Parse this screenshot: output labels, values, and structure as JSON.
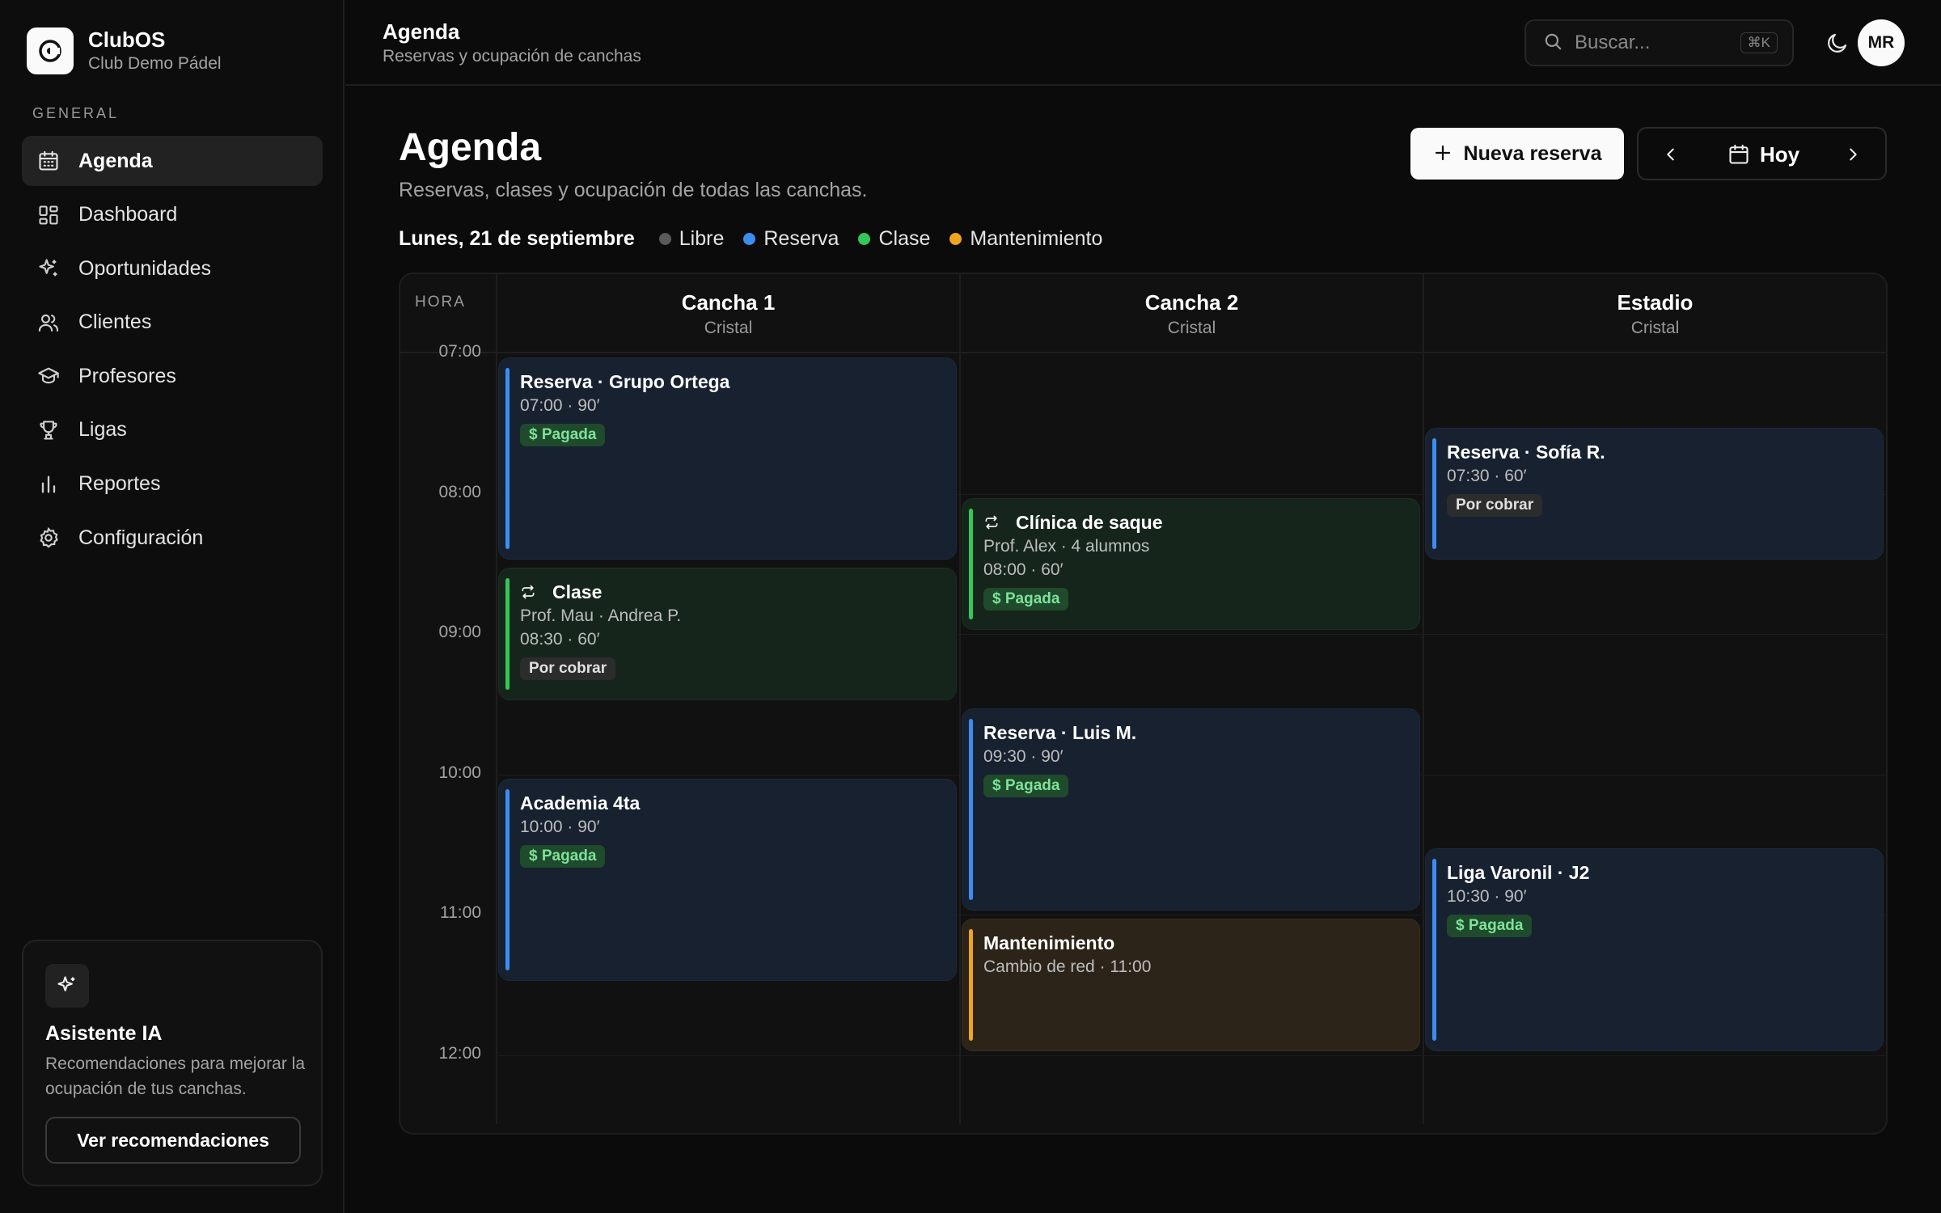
{
  "brand": {
    "name": "ClubOS",
    "club": "Club Demo Pádel"
  },
  "sidebar": {
    "section": "GENERAL",
    "items": [
      {
        "label": "Agenda",
        "icon": "calendar-icon",
        "active": true
      },
      {
        "label": "Dashboard",
        "icon": "grid-icon"
      },
      {
        "label": "Oportunidades",
        "icon": "sparkles-icon"
      },
      {
        "label": "Clientes",
        "icon": "users-icon"
      },
      {
        "label": "Profesores",
        "icon": "graduation-cap-icon"
      },
      {
        "label": "Ligas",
        "icon": "trophy-icon"
      },
      {
        "label": "Reportes",
        "icon": "bar-chart-icon"
      },
      {
        "label": "Configuración",
        "icon": "gear-icon"
      }
    ],
    "ai_card": {
      "title": "Asistente IA",
      "description": "Recomendaciones para mejorar la ocupación de tus canchas.",
      "button": "Ver recomendaciones"
    }
  },
  "topbar": {
    "title": "Agenda",
    "subtitle": "Reservas y ocupación de canchas",
    "search_placeholder": "Buscar...",
    "shortcut": "⌘K",
    "avatar_initials": "MR"
  },
  "main": {
    "title": "Agenda",
    "subtitle": "Reservas, clases y ocupación de todas las canchas.",
    "new_button": "Nueva reserva",
    "today_button": "Hoy",
    "date": "Lunes, 21 de septiembre",
    "legend": [
      {
        "label": "Libre",
        "color": "#5a5a5a"
      },
      {
        "label": "Reserva",
        "color": "#3b8ef0"
      },
      {
        "label": "Clase",
        "color": "#34c759"
      },
      {
        "label": "Mantenimiento",
        "color": "#f0a51f"
      }
    ]
  },
  "calendar": {
    "hour_header": "HORA",
    "times": [
      "07:00",
      "08:00",
      "09:00",
      "10:00",
      "11:00",
      "12:00"
    ],
    "courts": [
      {
        "name": "Cancha 1",
        "type": "Cristal"
      },
      {
        "name": "Cancha 2",
        "type": "Cristal"
      },
      {
        "name": "Estadio",
        "type": "Cristal"
      }
    ],
    "events": [
      {
        "court": 0,
        "kind": "reserva",
        "start": "07:00",
        "duration_min": 90,
        "title": "Reserva · Grupo Ortega",
        "lines": [
          "07:00 · 90′"
        ],
        "badge": "$ Pagada",
        "badge_kind": "paid"
      },
      {
        "court": 0,
        "kind": "clase",
        "start": "08:30",
        "duration_min": 60,
        "title": "Clase",
        "repeat": true,
        "lines": [
          "Prof. Mau · Andrea P.",
          "08:30 · 60′"
        ],
        "badge": "Por cobrar",
        "badge_kind": "due"
      },
      {
        "court": 0,
        "kind": "reserva",
        "start": "10:00",
        "duration_min": 90,
        "title": "Academia 4ta",
        "lines": [
          "10:00 · 90′"
        ],
        "badge": "$ Pagada",
        "badge_kind": "paid"
      },
      {
        "court": 1,
        "kind": "clase",
        "start": "08:00",
        "duration_min": 60,
        "title": "Clínica de saque",
        "repeat": true,
        "lines": [
          "Prof. Alex · 4 alumnos",
          "08:00 · 60′"
        ],
        "badge": "$ Pagada",
        "badge_kind": "paid"
      },
      {
        "court": 1,
        "kind": "reserva",
        "start": "09:30",
        "duration_min": 90,
        "title": "Reserva · Luis M.",
        "lines": [
          "09:30 · 90′"
        ],
        "badge": "$ Pagada",
        "badge_kind": "paid"
      },
      {
        "court": 1,
        "kind": "mant",
        "start": "11:00",
        "duration_min": 60,
        "title": "Mantenimiento",
        "lines": [
          "Cambio de red · 11:00"
        ],
        "badge": null,
        "badge_kind": null
      },
      {
        "court": 2,
        "kind": "reserva",
        "start": "07:30",
        "duration_min": 60,
        "title": "Reserva · Sofía R.",
        "lines": [
          "07:30 · 60′"
        ],
        "badge": "Por cobrar",
        "badge_kind": "due"
      },
      {
        "court": 2,
        "kind": "reserva",
        "start": "10:30",
        "duration_min": 90,
        "title": "Liga Varonil · J2",
        "lines": [
          "10:30 · 90′"
        ],
        "badge": "$ Pagada",
        "badge_kind": "paid"
      }
    ]
  }
}
